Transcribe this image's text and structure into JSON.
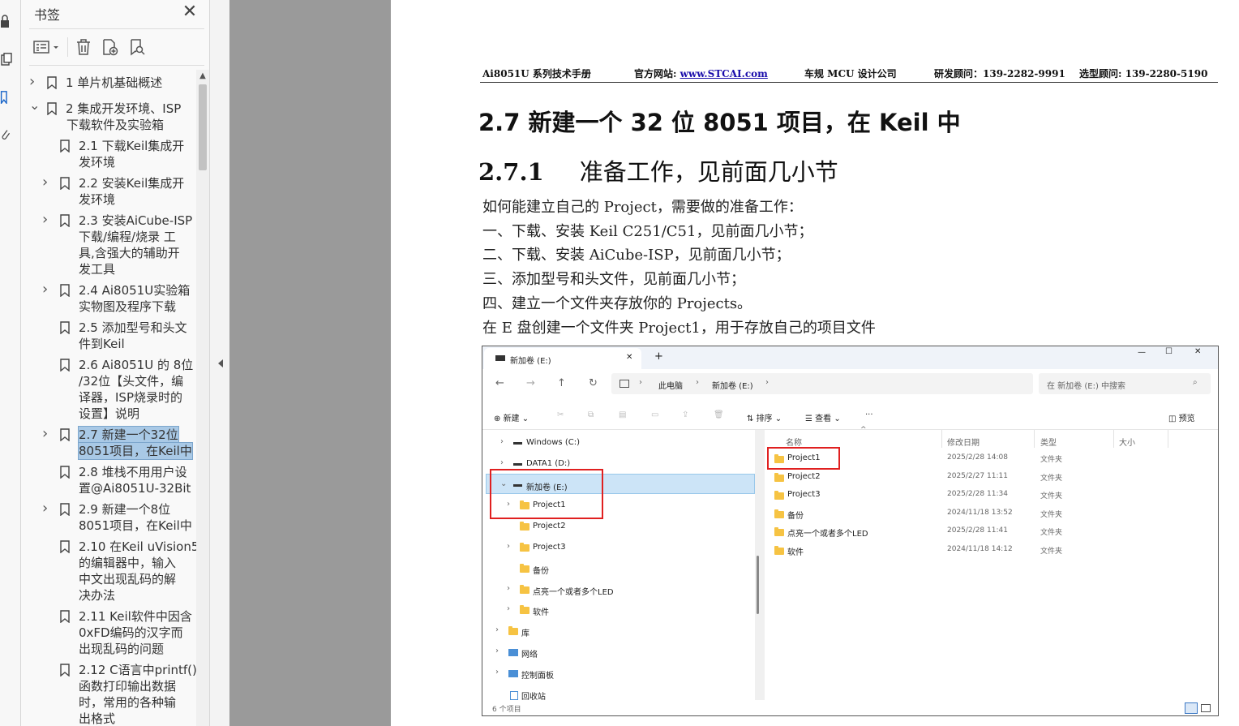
{
  "sidebar_rail": {
    "icons": [
      "lock-icon",
      "pages-icon",
      "bookmark-icon",
      "attachment-icon"
    ]
  },
  "bookmarks_panel": {
    "title": "书签",
    "toolbar_icons": [
      "options-icon",
      "delete-icon",
      "add-bookmark-icon",
      "find-bookmark-icon"
    ],
    "items": [
      {
        "label": "1  单片机基础概述",
        "level": 0,
        "expander": "collapsed"
      },
      {
        "label": "2  集成开发环境、ISP",
        "label2": "下载软件及实验箱",
        "level": 0,
        "expander": "expanded"
      },
      {
        "label": "2.1 下载Keil集成开",
        "label2": "发环境",
        "level": 1,
        "expander": "none"
      },
      {
        "label": "2.2  安装Keil集成开",
        "label2": "发环境",
        "level": 1,
        "expander": "collapsed"
      },
      {
        "label": "2.3  安装AiCube-ISP",
        "label2": "下载/编程/烧录 工",
        "label3": "具,含强大的辅助开",
        "label4": "发工具",
        "level": 1,
        "expander": "collapsed"
      },
      {
        "label": "2.4  Ai8051U实验箱",
        "label2": "实物图及程序下载",
        "level": 1,
        "expander": "collapsed"
      },
      {
        "label": "2.5  添加型号和头文",
        "label2": "件到Keil",
        "level": 1,
        "expander": "none"
      },
      {
        "label": "2.6  Ai8051U 的 8位",
        "label2": "/32位【头文件，编",
        "label3": "译器，ISP烧录时的",
        "label4": "设置】说明",
        "level": 1,
        "expander": "none"
      },
      {
        "label": "2.7 新建一个32位",
        "label2": "8051项目，在Keil中",
        "level": 1,
        "expander": "collapsed",
        "selected": true
      },
      {
        "label": "2.8  堆栈不用用户设",
        "label2": "置@Ai8051U-32Bit",
        "level": 1,
        "expander": "none"
      },
      {
        "label": "2.9  新建一个8位",
        "label2": "8051项目，在Keil中",
        "level": 1,
        "expander": "collapsed"
      },
      {
        "label": "2.10  在Keil uVision5",
        "label2": "的编辑器中，输入",
        "label3": "中文出现乱码的解",
        "label4": "决办法",
        "level": 1,
        "expander": "none"
      },
      {
        "label": "2.11  Keil软件中因含",
        "label2": "0xFD编码的汉字而",
        "label3": "出现乱码的问题",
        "level": 1,
        "expander": "none"
      },
      {
        "label": "2.12  C语言中printf()",
        "label2": "函数打印输出数据",
        "label3": "时，常用的各种输",
        "label4": "出格式",
        "level": 1,
        "expander": "none"
      }
    ]
  },
  "document": {
    "header": {
      "manual": "Ai8051U 系列技术手册",
      "site_label": "官方网站:",
      "site_url": "www.STCAI.com",
      "company": "车规 MCU 设计公司",
      "rd_contact": "研发顾问：139-2282-9991",
      "sales_contact": "选型顾问: 139-2280-5190"
    },
    "section_title": "2.7     新建一个 32 位 8051 项目，在 Keil 中",
    "subsection_num": "2.7.1",
    "subsection_title": "准备工作，见前面几小节",
    "paragraphs": [
      "如何能建立自己的 Project，需要做的准备工作：",
      "一、下载、安装 Keil C251/C51，见前面几小节；",
      "二、下载、安装 AiCube-ISP，见前面几小节；",
      "三、添加型号和头文件，见前面几小节；",
      "四、建立一个文件夹存放你的 Projects。",
      "在 E 盘创建一个文件夹 Project1，用于存放自己的项目文件"
    ]
  },
  "explorer": {
    "tab_title": "新加卷 (E:)",
    "tab_close": "✕",
    "new_tab": "+",
    "window_controls": [
      "—",
      "☐",
      "✕"
    ],
    "nav_buttons": [
      "←",
      "→",
      "↑",
      "↻"
    ],
    "breadcrumb": [
      "此电脑",
      "新加卷 (E:)"
    ],
    "search_placeholder": "在 新加卷 (E:) 中搜索",
    "commands": {
      "new": "新建",
      "sort": "排序",
      "view": "查看",
      "more": "···",
      "preview": "预览"
    },
    "tree": [
      {
        "label": "Windows (C:)",
        "indent": 0,
        "expander": ">",
        "kind": "drive"
      },
      {
        "label": "DATA1 (D:)",
        "indent": 0,
        "expander": ">",
        "kind": "drive"
      },
      {
        "label": "新加卷 (E:)",
        "indent": 0,
        "expander": "v",
        "kind": "drive",
        "selected": true
      },
      {
        "label": "Project1",
        "indent": 1,
        "expander": ">",
        "kind": "folder"
      },
      {
        "label": "Project2",
        "indent": 1,
        "expander": "",
        "kind": "folder"
      },
      {
        "label": "Project3",
        "indent": 1,
        "expander": ">",
        "kind": "folder"
      },
      {
        "label": "备份",
        "indent": 1,
        "expander": "",
        "kind": "folder"
      },
      {
        "label": "点亮一个或者多个LED",
        "indent": 1,
        "expander": ">",
        "kind": "folder"
      },
      {
        "label": "软件",
        "indent": 1,
        "expander": ">",
        "kind": "folder"
      },
      {
        "label": "库",
        "indent": -1,
        "expander": ">",
        "kind": "folder"
      },
      {
        "label": "网络",
        "indent": -1,
        "expander": ">",
        "kind": "network"
      },
      {
        "label": "控制面板",
        "indent": -1,
        "expander": ">",
        "kind": "control"
      },
      {
        "label": "回收站",
        "indent": -1,
        "expander": "",
        "kind": "recycle"
      }
    ],
    "columns": [
      "名称",
      "修改日期",
      "类型",
      "大小"
    ],
    "rows": [
      {
        "name": "Project1",
        "date": "2025/2/28 14:08",
        "type": "文件夹"
      },
      {
        "name": "Project2",
        "date": "2025/2/27 11:11",
        "type": "文件夹"
      },
      {
        "name": "Project3",
        "date": "2025/2/28 11:34",
        "type": "文件夹"
      },
      {
        "name": "备份",
        "date": "2024/11/18 13:52",
        "type": "文件夹"
      },
      {
        "name": "点亮一个或者多个LED",
        "date": "2025/2/28 11:41",
        "type": "文件夹"
      },
      {
        "name": "软件",
        "date": "2024/11/18 14:12",
        "type": "文件夹"
      }
    ],
    "status": "6 个项目",
    "highlight_color": "#e02020",
    "selection_color": "#cce4f7"
  }
}
